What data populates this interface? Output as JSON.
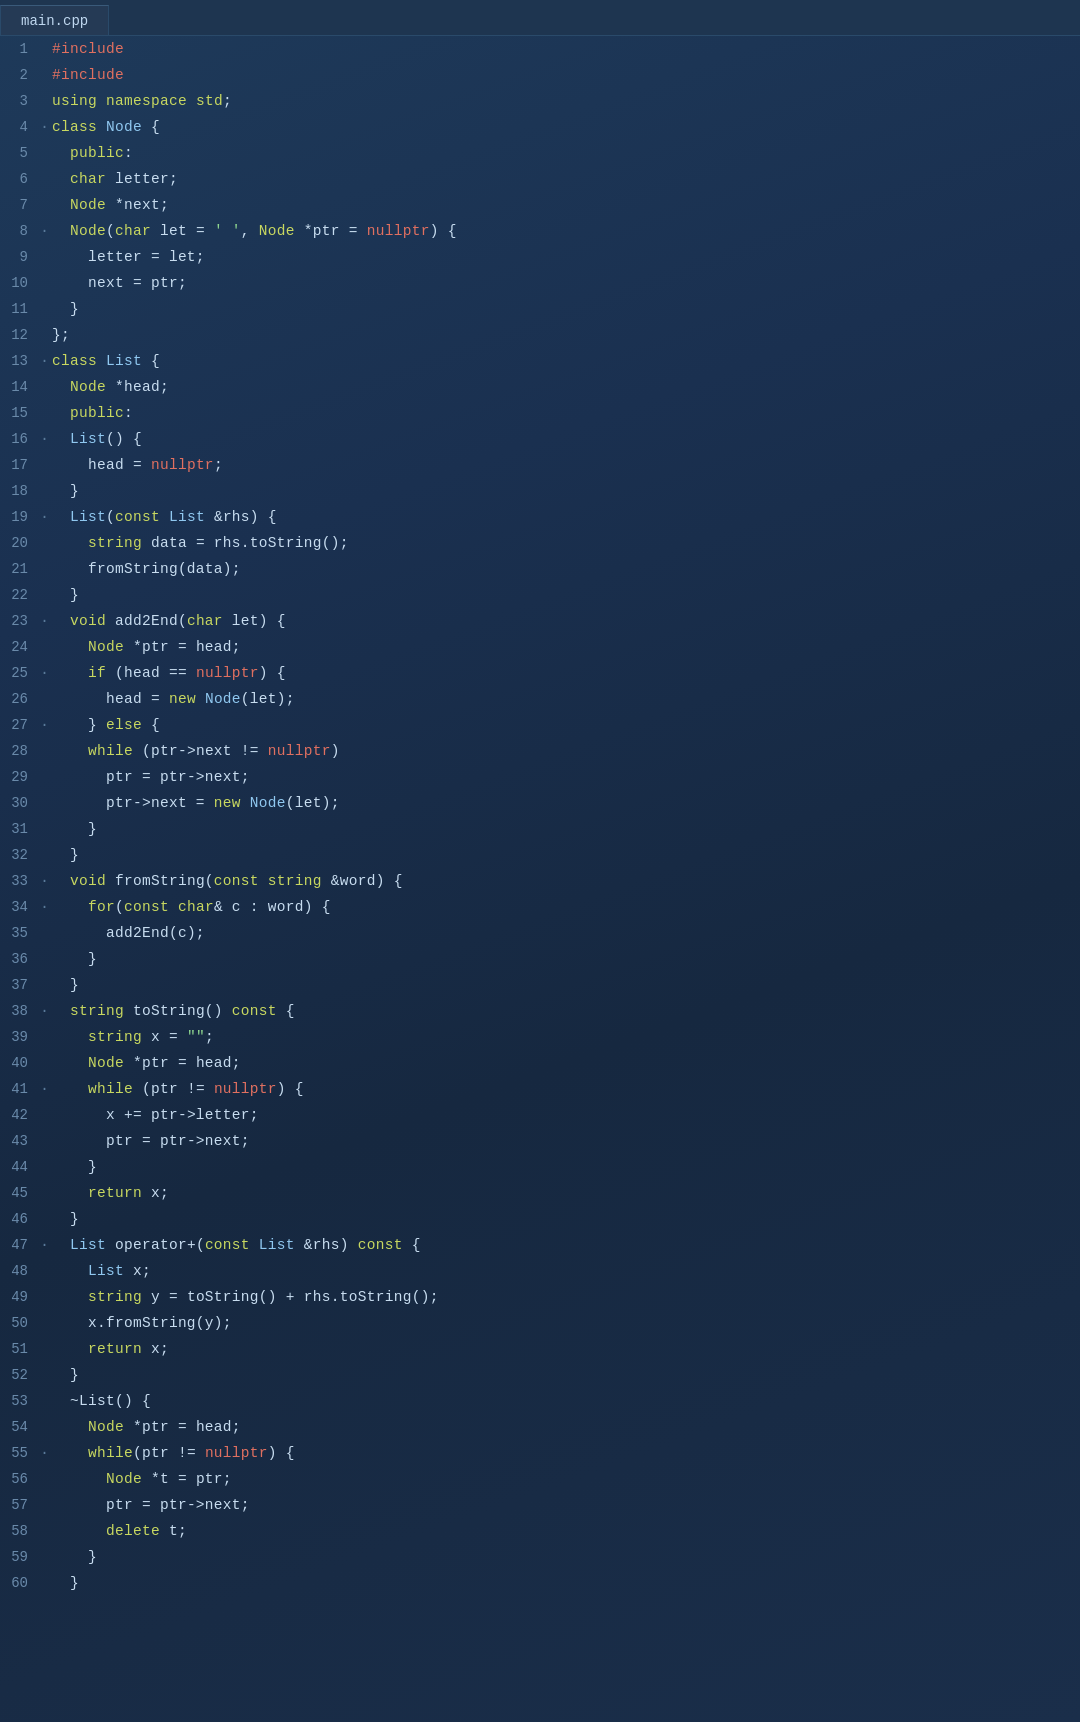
{
  "tab": {
    "label": "main.cpp"
  },
  "lines": [
    {
      "num": "1",
      "dot": "",
      "content": "#include"
    },
    {
      "num": "2",
      "dot": "",
      "content": "#include"
    },
    {
      "num": "3",
      "dot": "",
      "content": "using namespace std;"
    },
    {
      "num": "4",
      "dot": "·",
      "content": "class Node {"
    },
    {
      "num": "5",
      "dot": "",
      "content": "public:"
    },
    {
      "num": "6",
      "dot": "",
      "content": "char letter;"
    },
    {
      "num": "7",
      "dot": "",
      "content": "Node *next;"
    },
    {
      "num": "8",
      "dot": "·",
      "content": "Node(char let = ' ', Node *ptr = nullptr) {"
    },
    {
      "num": "9",
      "dot": "",
      "content": "letter = let;"
    },
    {
      "num": "10",
      "dot": "",
      "content": "next = ptr;"
    },
    {
      "num": "11",
      "dot": "",
      "content": "}"
    },
    {
      "num": "12",
      "dot": "",
      "content": "};"
    },
    {
      "num": "13",
      "dot": "·",
      "content": "class List {"
    },
    {
      "num": "14",
      "dot": "",
      "content": "Node *head;"
    },
    {
      "num": "15",
      "dot": "",
      "content": "public:"
    },
    {
      "num": "16",
      "dot": "·",
      "content": "List() {"
    },
    {
      "num": "17",
      "dot": "",
      "content": "head = nullptr;"
    },
    {
      "num": "18",
      "dot": "",
      "content": "}"
    },
    {
      "num": "19",
      "dot": "·",
      "content": "List(const List &rhs) {"
    },
    {
      "num": "20",
      "dot": "",
      "content": "string data = rhs.toString();"
    },
    {
      "num": "21",
      "dot": "",
      "content": "fromString(data);"
    },
    {
      "num": "22",
      "dot": "",
      "content": "}"
    },
    {
      "num": "23",
      "dot": "·",
      "content": "void add2End(char let) {"
    },
    {
      "num": "24",
      "dot": "",
      "content": "Node *ptr = head;"
    },
    {
      "num": "25",
      "dot": "·",
      "content": "if (head == nullptr) {"
    },
    {
      "num": "26",
      "dot": "",
      "content": "head = new Node(let);"
    },
    {
      "num": "27",
      "dot": "·",
      "content": "} else {"
    },
    {
      "num": "28",
      "dot": "",
      "content": "while (ptr->next != nullptr)"
    },
    {
      "num": "29",
      "dot": "",
      "content": "ptr = ptr->next;"
    },
    {
      "num": "30",
      "dot": "",
      "content": "ptr->next = new Node(let);"
    },
    {
      "num": "31",
      "dot": "",
      "content": "}"
    },
    {
      "num": "32",
      "dot": "",
      "content": "}"
    },
    {
      "num": "33",
      "dot": "·",
      "content": "void fromString(const string &word) {"
    },
    {
      "num": "34",
      "dot": "·",
      "content": "for(const char& c : word) {"
    },
    {
      "num": "35",
      "dot": "",
      "content": "add2End(c);"
    },
    {
      "num": "36",
      "dot": "",
      "content": "}"
    },
    {
      "num": "37",
      "dot": "",
      "content": "}"
    },
    {
      "num": "38",
      "dot": "·",
      "content": "string toString() const {"
    },
    {
      "num": "39",
      "dot": "",
      "content": "string x = \"\";"
    },
    {
      "num": "40",
      "dot": "",
      "content": "Node *ptr = head;"
    },
    {
      "num": "41",
      "dot": "·",
      "content": "while (ptr != nullptr) {"
    },
    {
      "num": "42",
      "dot": "",
      "content": "x += ptr->letter;"
    },
    {
      "num": "43",
      "dot": "",
      "content": "ptr = ptr->next;"
    },
    {
      "num": "44",
      "dot": "",
      "content": "}"
    },
    {
      "num": "45",
      "dot": "",
      "content": "return x;"
    },
    {
      "num": "46",
      "dot": "",
      "content": "}"
    },
    {
      "num": "47",
      "dot": "·",
      "content": "List operator+(const List &rhs) const {"
    },
    {
      "num": "48",
      "dot": "",
      "content": "List x;"
    },
    {
      "num": "49",
      "dot": "",
      "content": "string y = toString() + rhs.toString();"
    },
    {
      "num": "50",
      "dot": "",
      "content": "x.fromString(y);"
    },
    {
      "num": "51",
      "dot": "",
      "content": "return x;"
    },
    {
      "num": "52",
      "dot": "",
      "content": "}"
    },
    {
      "num": "53",
      "dot": "",
      "content": "~List() {"
    },
    {
      "num": "54",
      "dot": "",
      "content": "Node *ptr = head;"
    },
    {
      "num": "55",
      "dot": "·",
      "content": "while(ptr != nullptr) {"
    },
    {
      "num": "56",
      "dot": "",
      "content": "Node *t = ptr;"
    },
    {
      "num": "57",
      "dot": "",
      "content": "ptr = ptr->next;"
    },
    {
      "num": "58",
      "dot": "",
      "content": "delete t;"
    },
    {
      "num": "59",
      "dot": "",
      "content": "}"
    },
    {
      "num": "60",
      "dot": "",
      "content": "}"
    }
  ]
}
